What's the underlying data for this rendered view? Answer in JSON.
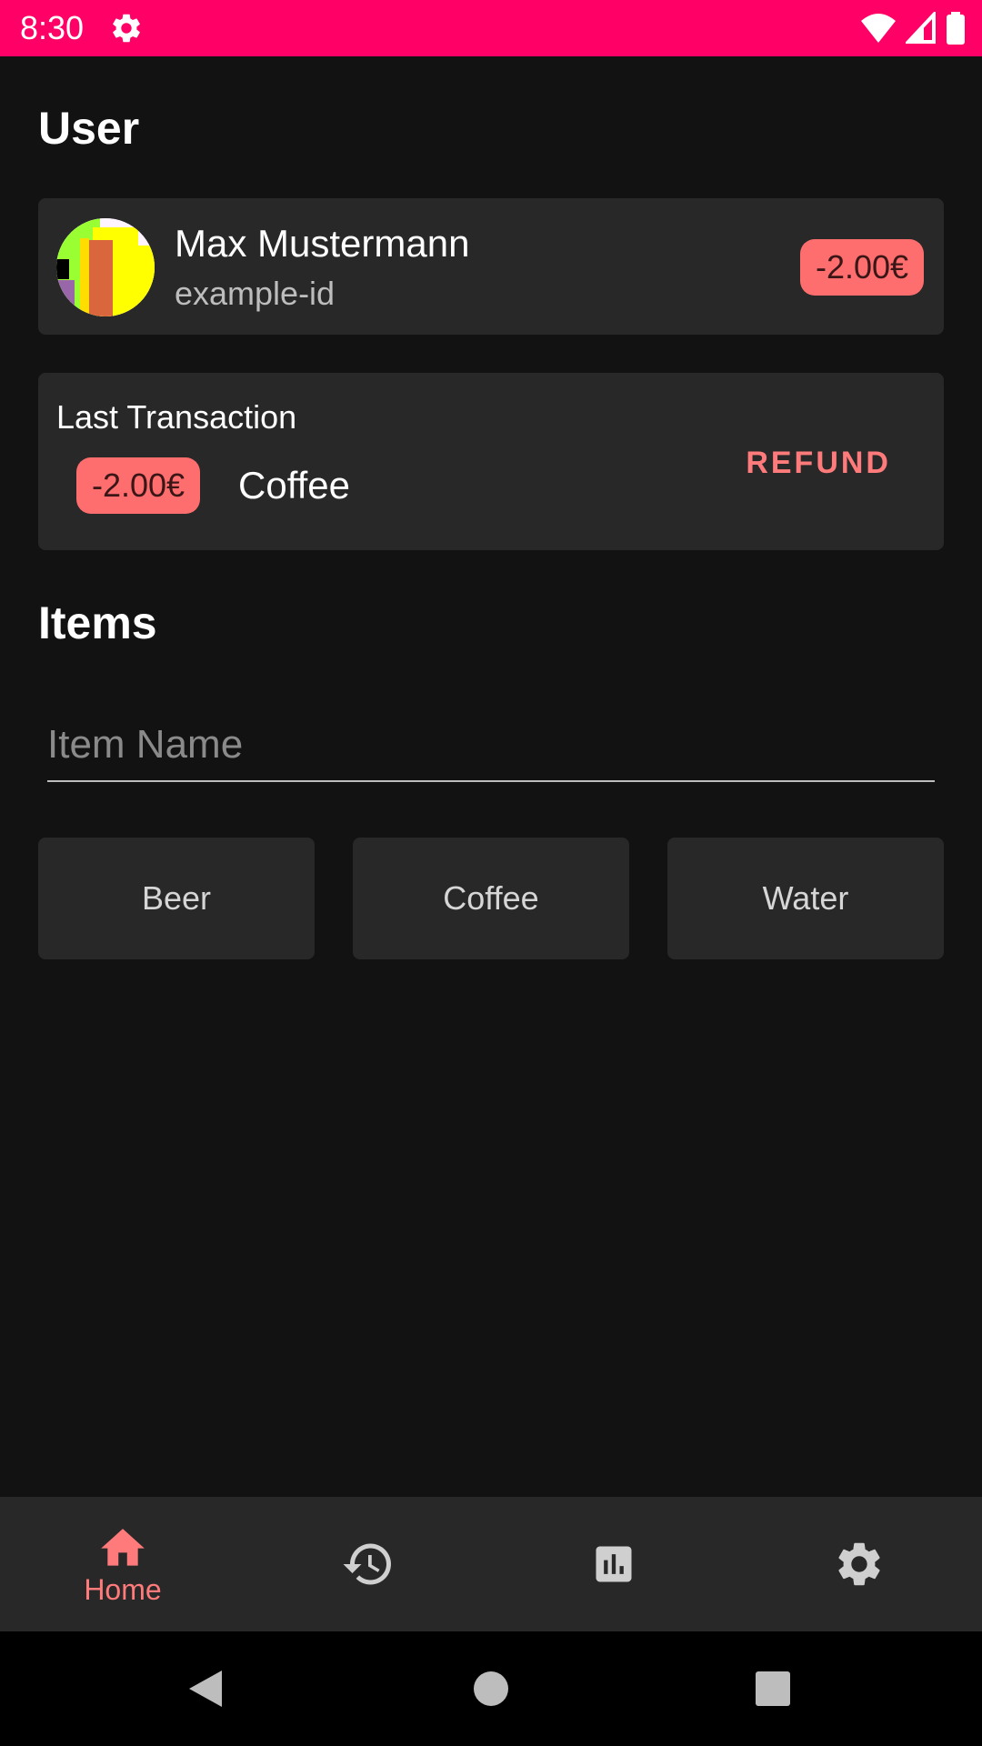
{
  "status_bar": {
    "time": "8:30",
    "background": "#ff0066"
  },
  "user_section": {
    "title": "User",
    "user": {
      "name": "Max Mustermann",
      "id": "example-id",
      "balance": "-2.00€"
    }
  },
  "last_transaction": {
    "title": "Last Transaction",
    "amount": "-2.00€",
    "item": "Coffee",
    "refund_label": "REFUND"
  },
  "items_section": {
    "title": "Items",
    "search": {
      "placeholder": "Item Name",
      "value": ""
    },
    "items": [
      {
        "label": "Beer"
      },
      {
        "label": "Coffee"
      },
      {
        "label": "Water"
      }
    ]
  },
  "bottom_nav": {
    "items": [
      {
        "icon": "home-icon",
        "label": "Home",
        "active": true
      },
      {
        "icon": "history-icon",
        "label": "",
        "active": false
      },
      {
        "icon": "bar-chart-icon",
        "label": "",
        "active": false
      },
      {
        "icon": "gear-icon",
        "label": "",
        "active": false
      }
    ]
  },
  "colors": {
    "accent": "#ff7b7b",
    "badge": "#ff6e6e",
    "card": "#282828",
    "background": "#121212"
  }
}
